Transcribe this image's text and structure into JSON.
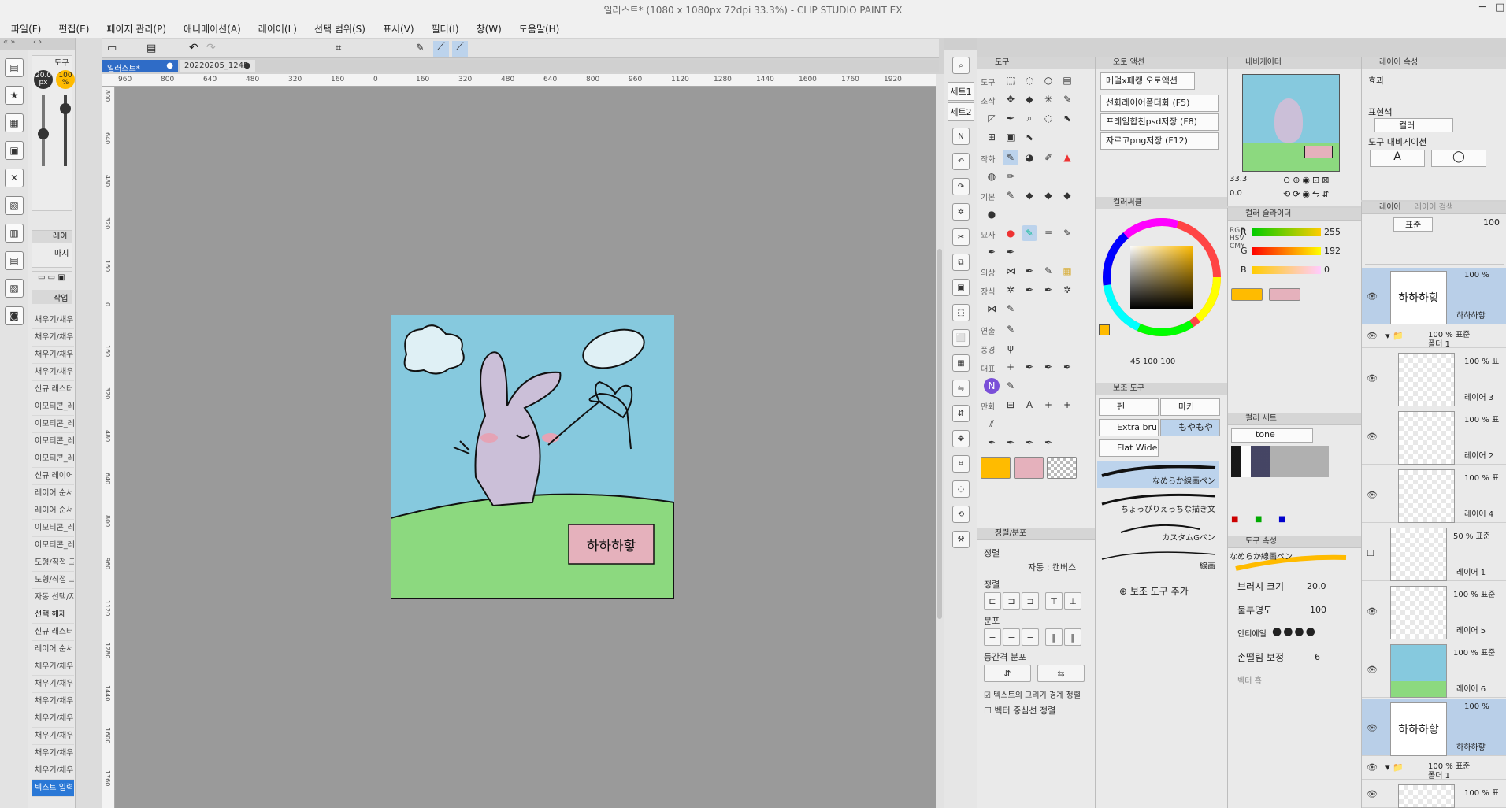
{
  "window": {
    "title": "일러스트* (1080 x 1080px 72dpi 33.3%)  - CLIP STUDIO PAINT EX"
  },
  "menu": [
    "파일(F)",
    "편집(E)",
    "페이지 관리(P)",
    "애니메이션(A)",
    "레이어(L)",
    "선택 범위(S)",
    "표시(V)",
    "필터(I)",
    "창(W)",
    "도움말(H)"
  ],
  "left_panel": {
    "tool_title": "도구",
    "brush_size": "20.0\npx",
    "opacity": "100\n%",
    "layer_mini_title": "레이",
    "layer_mini_item": "마지",
    "actions_title": "작업",
    "actions": [
      "채우기/채우",
      "채우기/채우",
      "채우기/채우",
      "채우기/채우",
      "신규 래스터",
      "이모티콘_레",
      "이모티콘_레",
      "이모티콘_레",
      "이모티콘_레",
      "신규 레이어",
      "레이어 순서",
      "레이어 순서",
      "이모티콘_레",
      "이모티콘_레",
      "도형/직접 그",
      "도형/직접 그",
      "자동 선택/지",
      "선택 해제",
      "신규 래스터",
      "레이어 순서",
      "채우기/채우",
      "채우기/채우",
      "채우기/채우",
      "채우기/채우",
      "채우기/채우",
      "채우기/채우",
      "채우기/채우",
      "텍스트 입력"
    ]
  },
  "canvas": {
    "tabs": [
      "일러스트*",
      "20220205_1245"
    ],
    "ruler_labels": [
      "960",
      "800",
      "640",
      "480",
      "320",
      "160",
      "0",
      "160",
      "320",
      "480",
      "640",
      "800",
      "960",
      "1120",
      "1280",
      "1440",
      "1600",
      "1760",
      "1920"
    ],
    "ruler_v_labels": [
      "800",
      "640",
      "480",
      "320",
      "160",
      "0",
      "160",
      "320",
      "480",
      "640",
      "800",
      "960",
      "1120",
      "1280",
      "1440",
      "1600",
      "1760"
    ],
    "art_text": "하하하핳",
    "status_zoom": "33.3",
    "status_angle": "0.0"
  },
  "command_strip": {
    "sets": [
      "세트1",
      "세트2"
    ]
  },
  "tool_panel": {
    "title": "도구",
    "categories": [
      "도구",
      "조작",
      "작화",
      "기본",
      "묘사",
      "의상",
      "장식",
      "연출",
      "풍경",
      "대표",
      "만화"
    ],
    "align_title": "정렬/분포",
    "align_label": "정렬",
    "align_mode": "자동 : 캔버스",
    "align_section": "정렬",
    "distribute_section": "분포",
    "equal_section": "등간격 분포",
    "check1": "텍스트의 그리기 경계 정렬",
    "check2": "벡터 중심선 정렬"
  },
  "auto_action": {
    "title": "오토 액션",
    "dropdown": "메멀x패캥 오토액션",
    "items": [
      "선화레이어폴더화 (F5)",
      "프레임합친psd저장 (F8)",
      "자르고png저장 (F12)"
    ]
  },
  "color_circle": {
    "title": "컬러써클",
    "hsv": "45",
    "s": "100",
    "v": "100"
  },
  "sub_tool": {
    "title": "보조 도구",
    "tabs": [
      "펜",
      "마커",
      "Extra bru",
      "もやもや",
      "Flat Wide"
    ],
    "strokes": [
      "なめらか線画ペン",
      "ちょっぴりえっちな描き文",
      "カスタムGペン",
      "線画"
    ],
    "add_label": "보조 도구 추가"
  },
  "navigator": {
    "title": "내비게이터",
    "zoom": "33.3",
    "angle": "0.0"
  },
  "color_slider": {
    "title": "컬러 슬라이더",
    "r": "255",
    "g": "192",
    "b": "0",
    "mode_labels": [
      "RGB",
      "HSV",
      "CMY"
    ]
  },
  "color_set": {
    "title": "컬러 세트",
    "dropdown": "tone"
  },
  "tool_property": {
    "title": "도구 속성",
    "brush_name": "なめらか線画ペン",
    "brush_size_label": "브러시 크기",
    "brush_size": "20.0",
    "opacity_label": "불투명도",
    "opacity": "100",
    "antialias_label": "안티에일",
    "stabilization_label": "손떨림 보정",
    "stabilization": "6",
    "vector_label": "벡터 흡"
  },
  "layer_property": {
    "title": "레이어 속성",
    "effect_label": "효과",
    "expression_label": "표현색",
    "expression_value": "컬러",
    "nav_label": "도구 내비게이션"
  },
  "layers": {
    "title": "레이어",
    "title2": "레이어 검색",
    "blend_mode": "표준",
    "opacity": "100",
    "rows": [
      {
        "kind": "text",
        "pct": "100 %",
        "name": "하하하핳",
        "thumb": "하하하핳"
      },
      {
        "kind": "folder",
        "pct": "100 % 표준",
        "name": "폴더 1"
      },
      {
        "kind": "layer",
        "pct": "100 % 표",
        "name": "레이어 3"
      },
      {
        "kind": "layer",
        "pct": "100 % 표",
        "name": "레이어 2"
      },
      {
        "kind": "layer",
        "pct": "100 % 표",
        "name": "레이어 4"
      },
      {
        "kind": "layer",
        "pct": "50 % 표준",
        "name": "레이어 1"
      },
      {
        "kind": "layer",
        "pct": "100 % 표준",
        "name": "레이어 5"
      },
      {
        "kind": "layer",
        "pct": "100 % 표준",
        "name": "레이어 6"
      },
      {
        "kind": "text",
        "pct": "100 %",
        "name": "하하하핳",
        "thumb": "하하하핳"
      },
      {
        "kind": "folder",
        "pct": "100 % 표준",
        "name": "폴더 1"
      },
      {
        "kind": "layer",
        "pct": "100 % 표",
        "name": ""
      }
    ]
  },
  "colors": {
    "main_color": "#ffbb00",
    "sub_color": "#e5b1bc",
    "sky": "#86c9de",
    "grass": "#8cd97f",
    "bunny": "#cbbfd8",
    "accent": "#2f6cc7"
  }
}
